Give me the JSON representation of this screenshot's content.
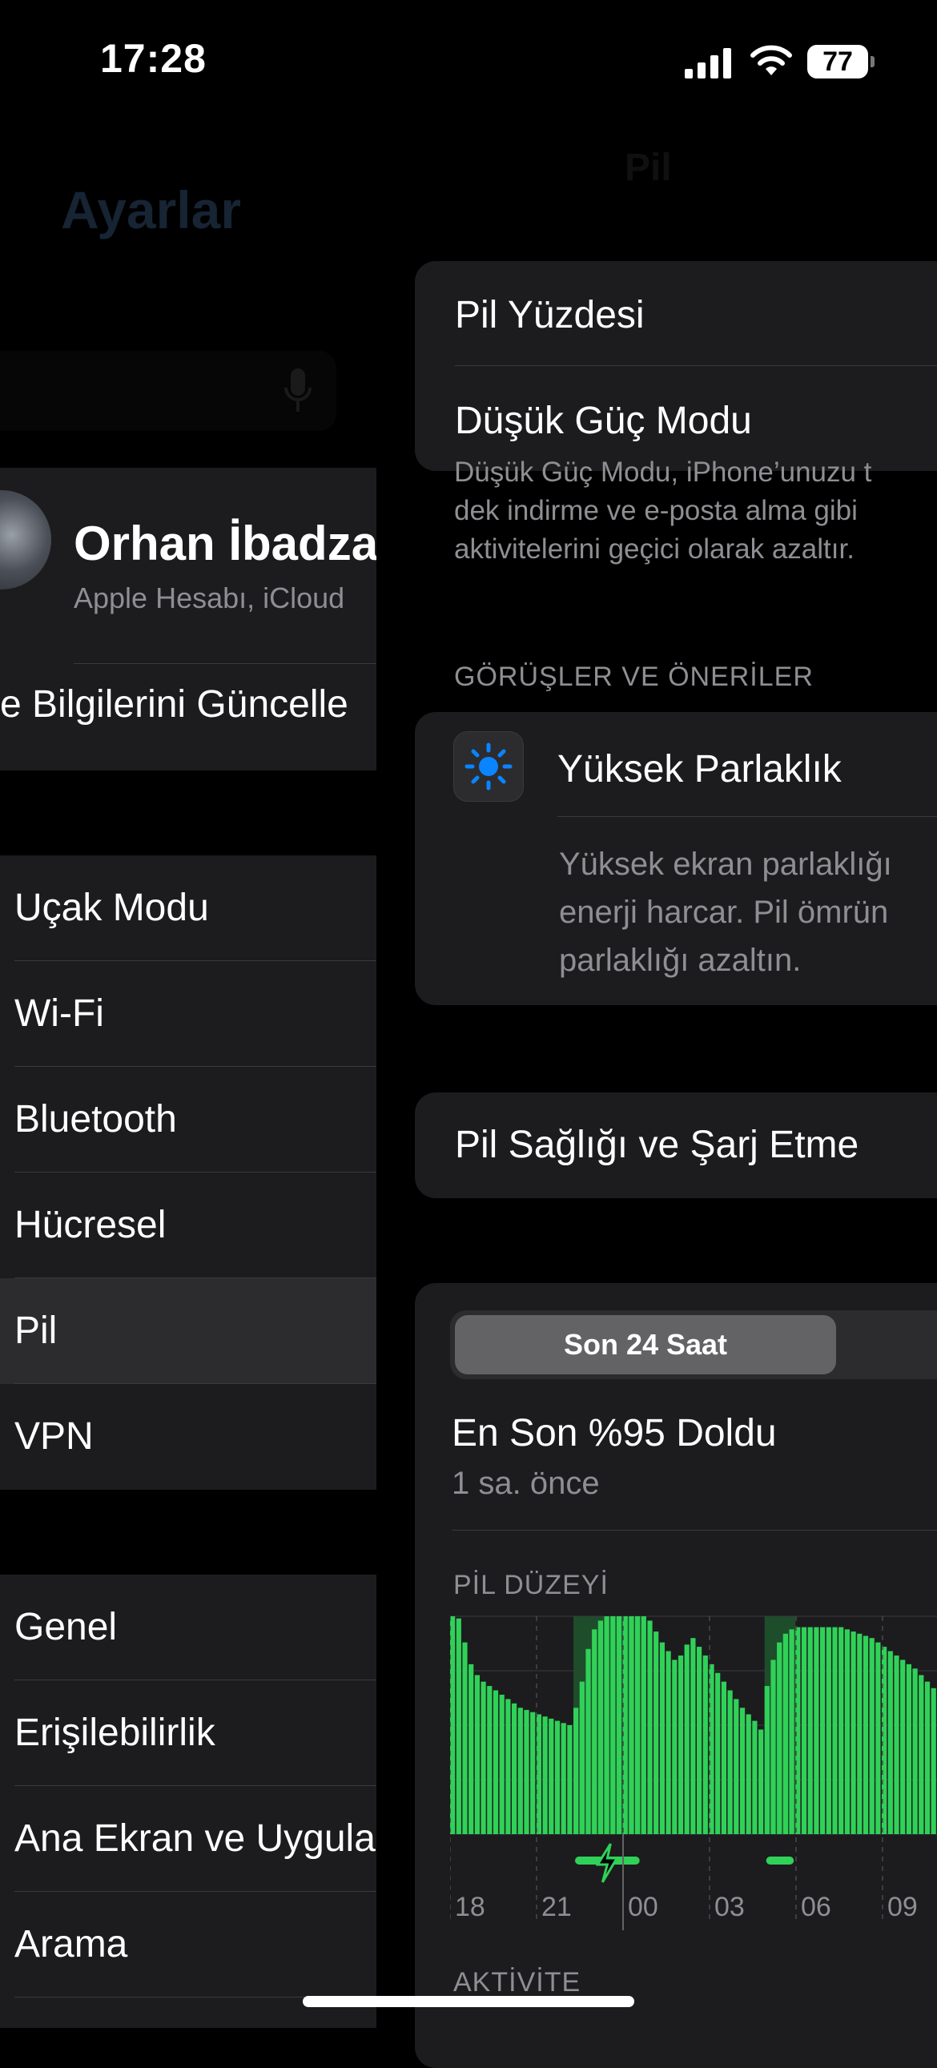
{
  "status_bar": {
    "time": "17:28",
    "battery_percent": "77"
  },
  "settings_panel": {
    "title": "Ayarlar",
    "profile": {
      "name": "Orhan İbadzad",
      "subtitle": "Apple Hesabı, iCloud",
      "update_label": "me Bilgilerini Güncelle"
    },
    "network_items": [
      {
        "label": "Uçak Modu"
      },
      {
        "label": "Wi-Fi"
      },
      {
        "label": "Bluetooth"
      },
      {
        "label": "Hücresel"
      },
      {
        "label": "Pil"
      },
      {
        "label": "VPN"
      }
    ],
    "general_items": [
      {
        "label": "Genel"
      },
      {
        "label": "Erişilebilirlik"
      },
      {
        "label": "Ana Ekran ve Uygula"
      },
      {
        "label": "Arama"
      }
    ]
  },
  "battery_panel": {
    "nav_title": "Pil",
    "battery_percentage_label": "Pil Yüzdesi",
    "low_power_label": "Düşük Güç Modu",
    "low_power_footer": [
      "Düşük Güç Modu, iPhone’unuzu t",
      "dek indirme ve e-posta alma gibi",
      "aktivitelerini geçici olarak azaltır."
    ],
    "insights_header": "GÖRÜŞLER VE ÖNERİLER",
    "recommendation": {
      "title": "Yüksek Parlaklık",
      "description": [
        "Yüksek ekran parlaklığı",
        "enerji harcar. Pil ömrün",
        "parlaklığı azaltın."
      ]
    },
    "health_label": "Pil Sağlığı ve Şarj Etme",
    "usage": {
      "segment_selected": "Son 24 Saat",
      "last_full_title": "En Son %95 Doldu",
      "last_full_time": "1 sa. önce",
      "battery_level_header": "PİL DÜZEYİ",
      "activity_header": "AKTİVİTE"
    }
  },
  "chart_data": {
    "type": "bar",
    "title": "PİL DÜZEYİ",
    "x_tick_labels": [
      "18",
      "21",
      "00",
      "03",
      "06",
      "09"
    ],
    "ylim": [
      0,
      100
    ],
    "bar_color": "#30d158",
    "charging_shade_color": "#1e4d2b",
    "values": [
      100,
      99,
      88,
      78,
      73,
      70,
      68,
      66,
      64,
      62,
      60,
      58,
      57,
      56,
      55,
      54,
      53,
      52,
      51,
      50,
      58,
      70,
      85,
      94,
      98,
      100,
      100,
      100,
      100,
      100,
      100,
      100,
      98,
      93,
      88,
      84,
      80,
      82,
      87,
      90,
      86,
      82,
      78,
      74,
      70,
      66,
      62,
      58,
      55,
      52,
      48,
      68,
      80,
      88,
      92,
      94,
      95,
      95,
      95,
      95,
      95,
      95,
      95,
      95,
      94,
      93,
      92,
      91,
      90,
      88,
      86,
      84,
      82,
      80,
      78,
      76,
      73,
      70,
      67,
      64,
      61,
      58,
      55,
      53,
      52,
      51,
      50,
      50
    ],
    "charging_ranges": [
      [
        20,
        31
      ],
      [
        51,
        56
      ]
    ]
  },
  "colors": {
    "accent_blue": "#0a84ff",
    "charge_green": "#30d158"
  }
}
